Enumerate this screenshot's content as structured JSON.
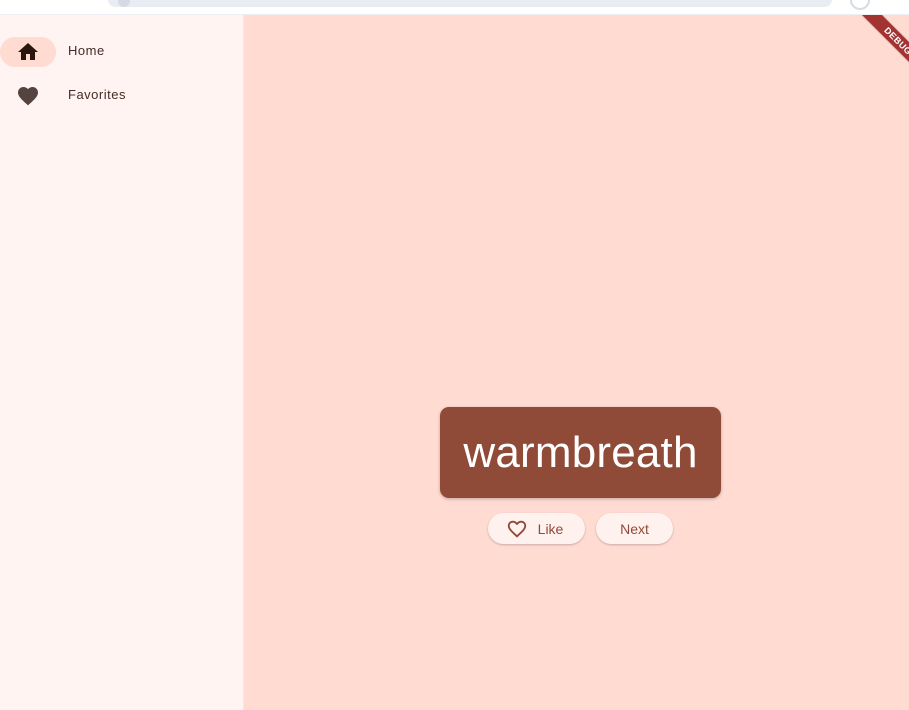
{
  "colors": {
    "rail_bg": "#fff4f2",
    "main_bg": "#ffdbd2",
    "selected_pill": "#ffdbd1",
    "card_bg": "#8f4a38",
    "button_bg": "#fff2ee",
    "accent": "#8f4a38",
    "debug_banner": "#a23333"
  },
  "nav": {
    "items": [
      {
        "label": "Home",
        "icon": "home-icon",
        "selected": true
      },
      {
        "label": "Favorites",
        "icon": "heart-icon",
        "selected": false
      }
    ]
  },
  "main": {
    "word": "warmbreath",
    "like_label": "Like",
    "like_icon": "heart-outline-icon",
    "next_label": "Next"
  },
  "debug": {
    "label": "DEBUG"
  }
}
